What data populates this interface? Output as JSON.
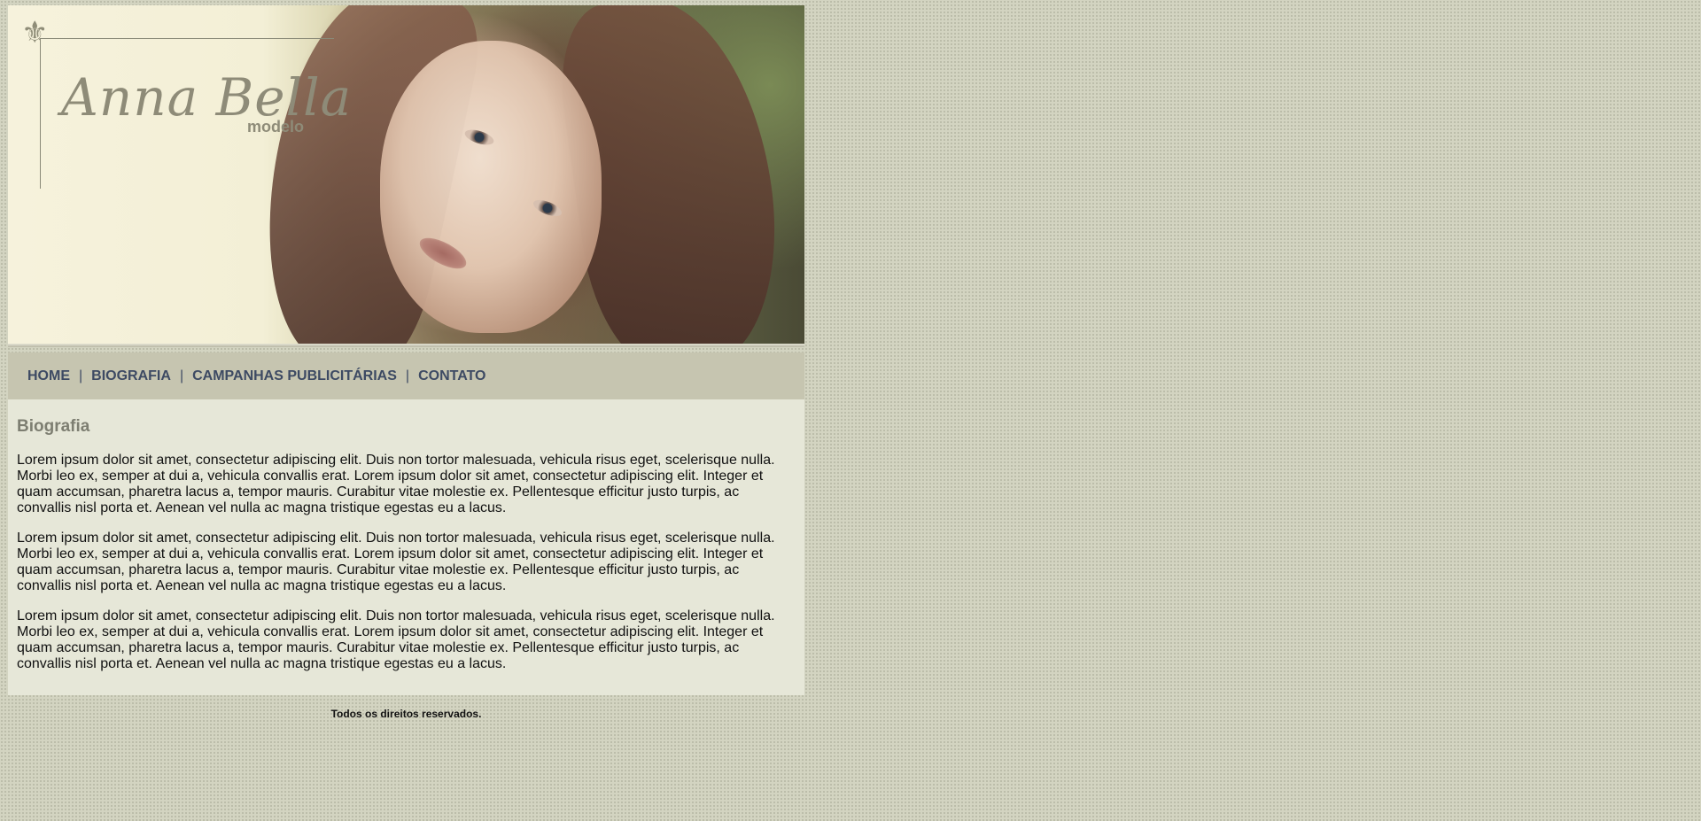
{
  "header": {
    "logo_name": "Anna Bella",
    "logo_sub": "modelo",
    "fleur_icon": "fleur-de-lis-icon"
  },
  "nav": {
    "items": [
      {
        "label": "HOME"
      },
      {
        "label": "BIOGRAFIA"
      },
      {
        "label": "CAMPANHAS PUBLICITÁRIAS"
      },
      {
        "label": "CONTATO"
      }
    ],
    "separator": "|"
  },
  "main": {
    "title": "Biografia",
    "paragraphs": [
      "Lorem ipsum dolor sit amet, consectetur adipiscing elit. Duis non tortor malesuada, vehicula risus eget, scelerisque nulla. Morbi leo ex, semper at dui a, vehicula convallis erat. Lorem ipsum dolor sit amet, consectetur adipiscing elit. Integer et quam accumsan, pharetra lacus a, tempor mauris. Curabitur vitae molestie ex. Pellentesque efficitur justo turpis, ac convallis nisl porta et. Aenean vel nulla ac magna tristique egestas eu a lacus.",
      "Lorem ipsum dolor sit amet, consectetur adipiscing elit. Duis non tortor malesuada, vehicula risus eget, scelerisque nulla. Morbi leo ex, semper at dui a, vehicula convallis erat. Lorem ipsum dolor sit amet, consectetur adipiscing elit. Integer et quam accumsan, pharetra lacus a, tempor mauris. Curabitur vitae molestie ex. Pellentesque efficitur justo turpis, ac convallis nisl porta et. Aenean vel nulla ac magna tristique egestas eu a lacus.",
      "Lorem ipsum dolor sit amet, consectetur adipiscing elit. Duis non tortor malesuada, vehicula risus eget, scelerisque nulla. Morbi leo ex, semper at dui a, vehicula convallis erat. Lorem ipsum dolor sit amet, consectetur adipiscing elit. Integer et quam accumsan, pharetra lacus a, tempor mauris. Curabitur vitae molestie ex. Pellentesque efficitur justo turpis, ac convallis nisl porta et. Aenean vel nulla ac magna tristique egestas eu a lacus."
    ]
  },
  "footer": {
    "text": "Todos os direitos reservados."
  },
  "colors": {
    "background": "#d3d4c1",
    "nav_bg": "#c6c5b0",
    "nav_link": "#3d4a63",
    "content_bg": "#e6e7d8",
    "title": "#7d7e71"
  }
}
